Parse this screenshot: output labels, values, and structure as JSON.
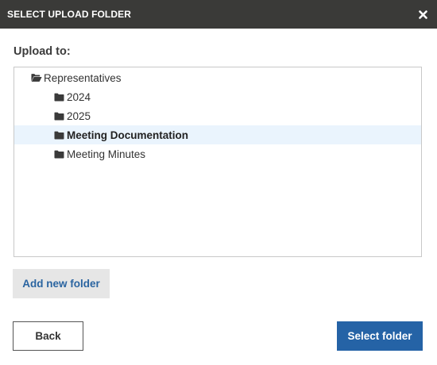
{
  "dialog": {
    "title": "SELECT UPLOAD FOLDER",
    "close_icon": "close-icon"
  },
  "upload_label": "Upload to:",
  "tree": {
    "root": {
      "label": "Representatives",
      "icon": "folder-open-icon"
    },
    "children": [
      {
        "label": "2024",
        "icon": "folder-icon",
        "selected": false
      },
      {
        "label": "2025",
        "icon": "folder-icon",
        "selected": false
      },
      {
        "label": "Meeting Documentation",
        "icon": "folder-icon",
        "selected": true
      },
      {
        "label": "Meeting Minutes",
        "icon": "folder-icon",
        "selected": false
      }
    ]
  },
  "buttons": {
    "add_folder": "Add new folder",
    "back": "Back",
    "select_folder": "Select folder"
  },
  "colors": {
    "titlebar": "#3a3a38",
    "primary": "#2563a6",
    "selected_row": "#eaf4fd",
    "link_text": "#2a64a0"
  }
}
